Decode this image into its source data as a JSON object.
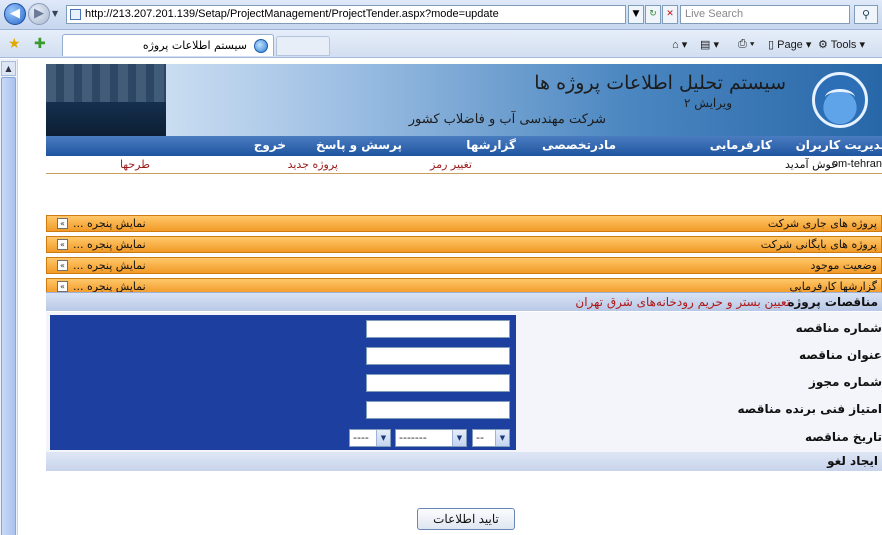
{
  "browser": {
    "url": "http://213.207.201.139/Setap/ProjectManagement/ProjectTender.aspx?mode=update",
    "search_placeholder": "Live Search",
    "tab_title": "سیستم اطلاعات پروژه",
    "page_label": "Page",
    "tools_label": "Tools"
  },
  "banner": {
    "title": "سیستم تحلیل اطلاعات پروژه ها",
    "version": "ویرایش ۲",
    "company": "شرکت مهندسی آب و فاضلاب کشور"
  },
  "menu": {
    "items": [
      "مدیریت کاربران",
      "کارفرمایی",
      "مادرتخصصی",
      "گزارشها",
      "پرسش و پاسخ",
      "خروج"
    ]
  },
  "subbar": {
    "user": "om-tehran",
    "welcome": "خوش آمدید",
    "links": [
      "تغییر رمز",
      "پروژه جدید",
      "طرحها"
    ]
  },
  "panels": [
    {
      "title": "پروژه های جاری شرکت",
      "show": "نمایش پنجره ..."
    },
    {
      "title": "پروژه های بایگانی شرکت",
      "show": "نمایش پنجره ..."
    },
    {
      "title": "وضعیت موجود",
      "show": "نمایش پنجره ..."
    },
    {
      "title": "گزارشها کارفرمایی",
      "show": "نمایش پنجره ..."
    }
  ],
  "tender": {
    "label": "مناقصات پروژه",
    "project_name": "تعیین بستر و حریم رودخانه‌های شرق تهران",
    "fields": [
      {
        "label": "شماره مناقصه",
        "value": ""
      },
      {
        "label": "عنوان مناقصه",
        "value": ""
      },
      {
        "label": "شماره مجوز",
        "value": ""
      },
      {
        "label": "امتیاز فنی برنده مناقصه",
        "value": ""
      },
      {
        "label": "تاریخ مناقصه",
        "value": ""
      }
    ],
    "date_selects": {
      "day": "--",
      "month": "-------",
      "year": "----"
    },
    "cancel_label": "ایجاد لغو",
    "submit_label": "تایید اطلاعات"
  }
}
